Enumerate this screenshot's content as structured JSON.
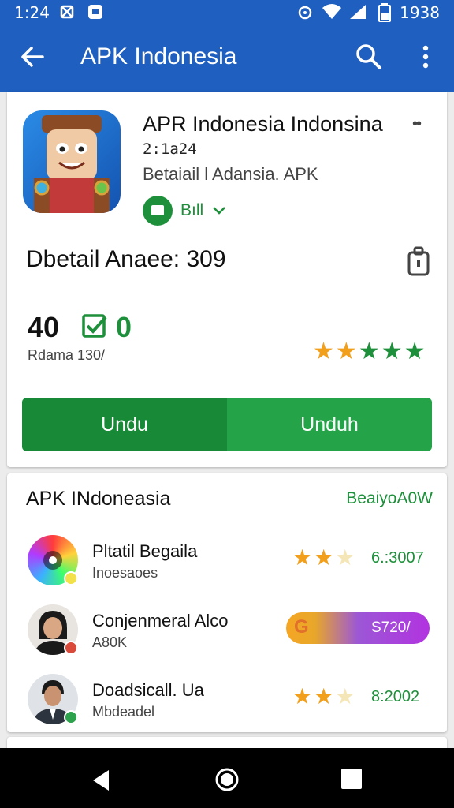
{
  "status_bar": {
    "time": "1:24",
    "clock": "1938",
    "icons": [
      "bug-icon",
      "notification-icon",
      "alarm-icon",
      "wifi-icon",
      "signal-icon",
      "battery-icon"
    ]
  },
  "app_bar": {
    "title": "APK Indonesia",
    "icons": [
      "back-arrow-icon",
      "search-icon",
      "more-vert-icon"
    ]
  },
  "app": {
    "name": "APR Indonesia Indonsina",
    "version": "2:1a24",
    "subtitle": "Betaiail l Adansia. APK",
    "download_label": "Bıll",
    "icon": "game-character-icon"
  },
  "detail": {
    "title": "Dbetail Anaee: 309",
    "lock_icon": "lock-icon"
  },
  "stats": {
    "primary": "40",
    "secondary": "0",
    "sub": "Rdama 130/",
    "rating_stars": 5,
    "star_colors": [
      "#f29f1b",
      "#f29f1b",
      "#1e8f3a",
      "#1e8f3a",
      "#1e8f3a"
    ]
  },
  "buttons": {
    "left": "Undu",
    "right": "Unduh"
  },
  "section": {
    "title": "APK INdoneasia",
    "link": "BeaiyoA0W"
  },
  "list": [
    {
      "title": "Pltatil Begaila",
      "sub": "Inoesaoes",
      "value": "6.:3007",
      "rating": 2.5
    },
    {
      "title": "Conjenmeral Alco",
      "sub": "A80K",
      "value": "S720/",
      "pill_letter": "G"
    },
    {
      "title": "Doadsicall. Ua",
      "sub": "Mbdeadel",
      "value": "8:2002",
      "rating": 2.5
    }
  ],
  "colors": {
    "app_bar": "#1f5fbf",
    "accent_green": "#1e8f3a",
    "star_orange": "#f29f1b"
  }
}
